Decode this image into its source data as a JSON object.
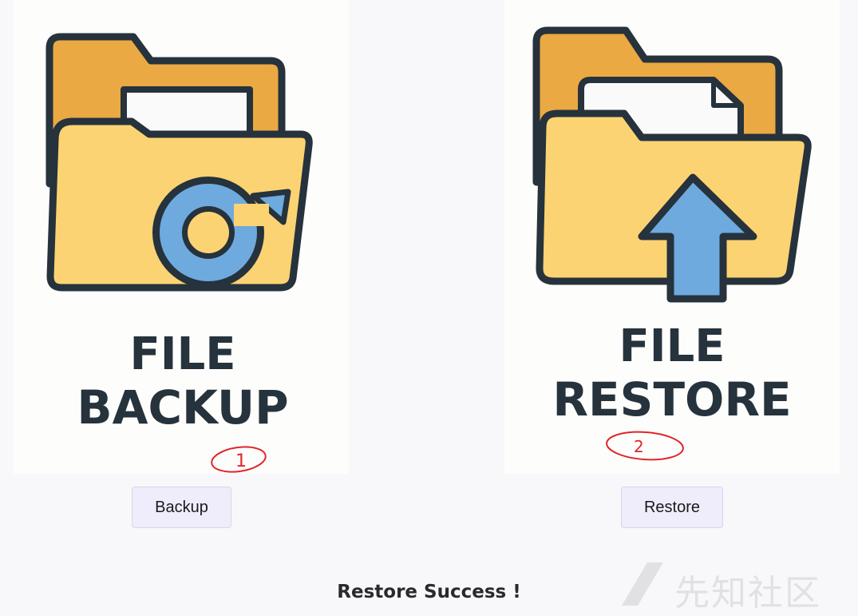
{
  "cards": {
    "backup": {
      "title_line1": "FILE",
      "title_line2": "BACKUP",
      "annotation": "1",
      "icon": "folder-backup-icon"
    },
    "restore": {
      "title_line1": "FILE",
      "title_line2": "RESTORE",
      "annotation": "2",
      "icon": "folder-restore-icon"
    }
  },
  "buttons": {
    "backup_label": "Backup",
    "restore_label": "Restore"
  },
  "status": {
    "message": "Restore Success !"
  },
  "watermark": {
    "text": "先知社区"
  },
  "colors": {
    "folder_back": "#eaa942",
    "folder_front": "#fcd372",
    "outline": "#26323c",
    "accent_blue": "#6eaade",
    "annotation_red": "#e0262a",
    "button_bg": "#efedfc"
  }
}
